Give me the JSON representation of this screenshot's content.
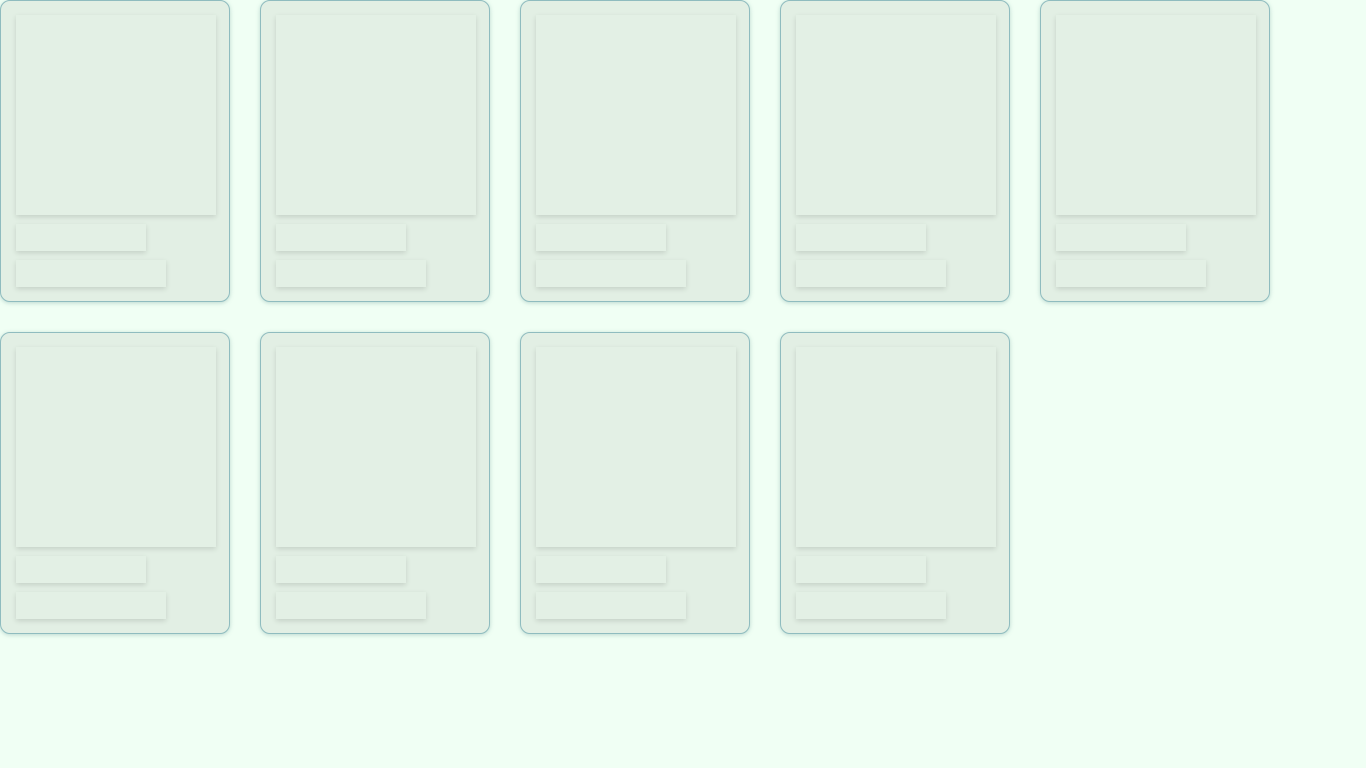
{
  "page": {
    "background_color": "#f0fff4",
    "card_color": "#e2efe4",
    "card_border_color": "#8fbcbf",
    "state": "loading-skeleton"
  },
  "cards": [
    {
      "thumbnail": "",
      "title": "",
      "subtitle": ""
    },
    {
      "thumbnail": "",
      "title": "",
      "subtitle": ""
    },
    {
      "thumbnail": "",
      "title": "",
      "subtitle": ""
    },
    {
      "thumbnail": "",
      "title": "",
      "subtitle": ""
    },
    {
      "thumbnail": "",
      "title": "",
      "subtitle": ""
    },
    {
      "thumbnail": "",
      "title": "",
      "subtitle": ""
    },
    {
      "thumbnail": "",
      "title": "",
      "subtitle": ""
    },
    {
      "thumbnail": "",
      "title": "",
      "subtitle": ""
    },
    {
      "thumbnail": "",
      "title": "",
      "subtitle": ""
    }
  ]
}
